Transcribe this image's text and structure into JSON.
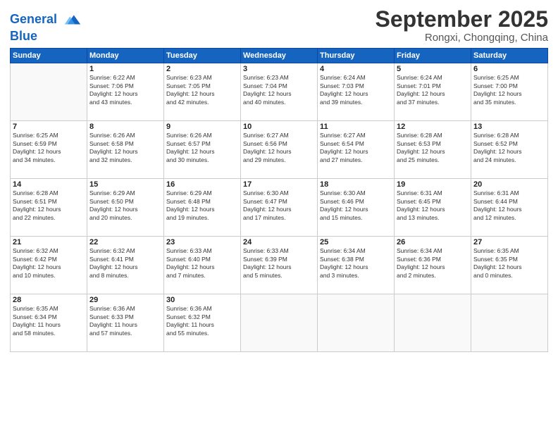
{
  "header": {
    "logo_line1": "General",
    "logo_line2": "Blue",
    "month_year": "September 2025",
    "location": "Rongxi, Chongqing, China"
  },
  "weekdays": [
    "Sunday",
    "Monday",
    "Tuesday",
    "Wednesday",
    "Thursday",
    "Friday",
    "Saturday"
  ],
  "weeks": [
    [
      {
        "day": "",
        "info": ""
      },
      {
        "day": "1",
        "info": "Sunrise: 6:22 AM\nSunset: 7:06 PM\nDaylight: 12 hours\nand 43 minutes."
      },
      {
        "day": "2",
        "info": "Sunrise: 6:23 AM\nSunset: 7:05 PM\nDaylight: 12 hours\nand 42 minutes."
      },
      {
        "day": "3",
        "info": "Sunrise: 6:23 AM\nSunset: 7:04 PM\nDaylight: 12 hours\nand 40 minutes."
      },
      {
        "day": "4",
        "info": "Sunrise: 6:24 AM\nSunset: 7:03 PM\nDaylight: 12 hours\nand 39 minutes."
      },
      {
        "day": "5",
        "info": "Sunrise: 6:24 AM\nSunset: 7:01 PM\nDaylight: 12 hours\nand 37 minutes."
      },
      {
        "day": "6",
        "info": "Sunrise: 6:25 AM\nSunset: 7:00 PM\nDaylight: 12 hours\nand 35 minutes."
      }
    ],
    [
      {
        "day": "7",
        "info": "Sunrise: 6:25 AM\nSunset: 6:59 PM\nDaylight: 12 hours\nand 34 minutes."
      },
      {
        "day": "8",
        "info": "Sunrise: 6:26 AM\nSunset: 6:58 PM\nDaylight: 12 hours\nand 32 minutes."
      },
      {
        "day": "9",
        "info": "Sunrise: 6:26 AM\nSunset: 6:57 PM\nDaylight: 12 hours\nand 30 minutes."
      },
      {
        "day": "10",
        "info": "Sunrise: 6:27 AM\nSunset: 6:56 PM\nDaylight: 12 hours\nand 29 minutes."
      },
      {
        "day": "11",
        "info": "Sunrise: 6:27 AM\nSunset: 6:54 PM\nDaylight: 12 hours\nand 27 minutes."
      },
      {
        "day": "12",
        "info": "Sunrise: 6:28 AM\nSunset: 6:53 PM\nDaylight: 12 hours\nand 25 minutes."
      },
      {
        "day": "13",
        "info": "Sunrise: 6:28 AM\nSunset: 6:52 PM\nDaylight: 12 hours\nand 24 minutes."
      }
    ],
    [
      {
        "day": "14",
        "info": "Sunrise: 6:28 AM\nSunset: 6:51 PM\nDaylight: 12 hours\nand 22 minutes."
      },
      {
        "day": "15",
        "info": "Sunrise: 6:29 AM\nSunset: 6:50 PM\nDaylight: 12 hours\nand 20 minutes."
      },
      {
        "day": "16",
        "info": "Sunrise: 6:29 AM\nSunset: 6:48 PM\nDaylight: 12 hours\nand 19 minutes."
      },
      {
        "day": "17",
        "info": "Sunrise: 6:30 AM\nSunset: 6:47 PM\nDaylight: 12 hours\nand 17 minutes."
      },
      {
        "day": "18",
        "info": "Sunrise: 6:30 AM\nSunset: 6:46 PM\nDaylight: 12 hours\nand 15 minutes."
      },
      {
        "day": "19",
        "info": "Sunrise: 6:31 AM\nSunset: 6:45 PM\nDaylight: 12 hours\nand 13 minutes."
      },
      {
        "day": "20",
        "info": "Sunrise: 6:31 AM\nSunset: 6:44 PM\nDaylight: 12 hours\nand 12 minutes."
      }
    ],
    [
      {
        "day": "21",
        "info": "Sunrise: 6:32 AM\nSunset: 6:42 PM\nDaylight: 12 hours\nand 10 minutes."
      },
      {
        "day": "22",
        "info": "Sunrise: 6:32 AM\nSunset: 6:41 PM\nDaylight: 12 hours\nand 8 minutes."
      },
      {
        "day": "23",
        "info": "Sunrise: 6:33 AM\nSunset: 6:40 PM\nDaylight: 12 hours\nand 7 minutes."
      },
      {
        "day": "24",
        "info": "Sunrise: 6:33 AM\nSunset: 6:39 PM\nDaylight: 12 hours\nand 5 minutes."
      },
      {
        "day": "25",
        "info": "Sunrise: 6:34 AM\nSunset: 6:38 PM\nDaylight: 12 hours\nand 3 minutes."
      },
      {
        "day": "26",
        "info": "Sunrise: 6:34 AM\nSunset: 6:36 PM\nDaylight: 12 hours\nand 2 minutes."
      },
      {
        "day": "27",
        "info": "Sunrise: 6:35 AM\nSunset: 6:35 PM\nDaylight: 12 hours\nand 0 minutes."
      }
    ],
    [
      {
        "day": "28",
        "info": "Sunrise: 6:35 AM\nSunset: 6:34 PM\nDaylight: 11 hours\nand 58 minutes."
      },
      {
        "day": "29",
        "info": "Sunrise: 6:36 AM\nSunset: 6:33 PM\nDaylight: 11 hours\nand 57 minutes."
      },
      {
        "day": "30",
        "info": "Sunrise: 6:36 AM\nSunset: 6:32 PM\nDaylight: 11 hours\nand 55 minutes."
      },
      {
        "day": "",
        "info": ""
      },
      {
        "day": "",
        "info": ""
      },
      {
        "day": "",
        "info": ""
      },
      {
        "day": "",
        "info": ""
      }
    ]
  ]
}
